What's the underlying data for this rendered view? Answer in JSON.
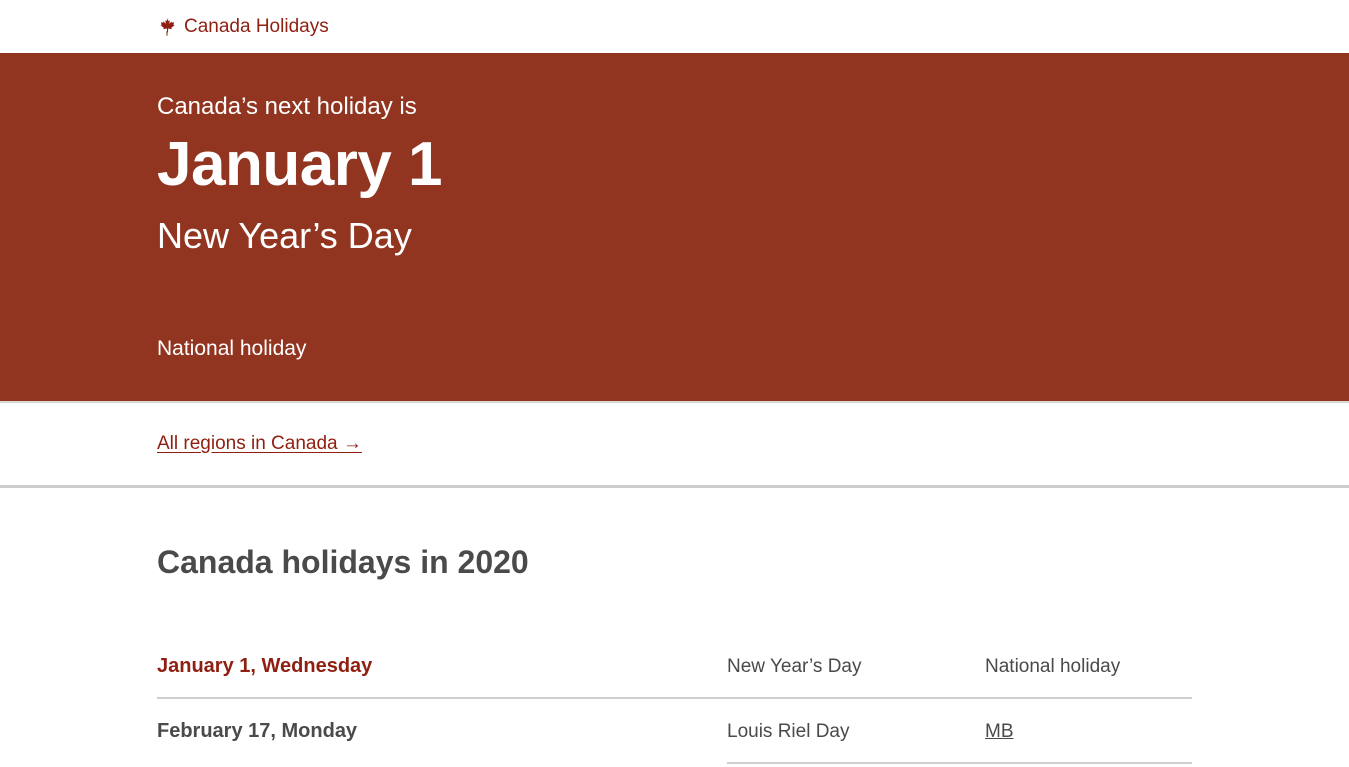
{
  "header": {
    "brand_label": "Canada Holidays",
    "brand_icon": "maple-leaf-icon",
    "brand_color": "#8f1f10"
  },
  "hero": {
    "lead": "Canada’s next holiday is",
    "date": "January 1",
    "name": "New Year’s Day",
    "type": "National holiday",
    "background": "#923520"
  },
  "regions_link": "All regions in Canada →",
  "listing": {
    "title": "Canada holidays in 2020",
    "rows": [
      {
        "date": "January 1, Wednesday",
        "name": "New Year’s Day",
        "type": "National holiday"
      },
      {
        "date": "February 17, Monday",
        "name": "Louis Riel Day",
        "type": "MB"
      }
    ]
  }
}
